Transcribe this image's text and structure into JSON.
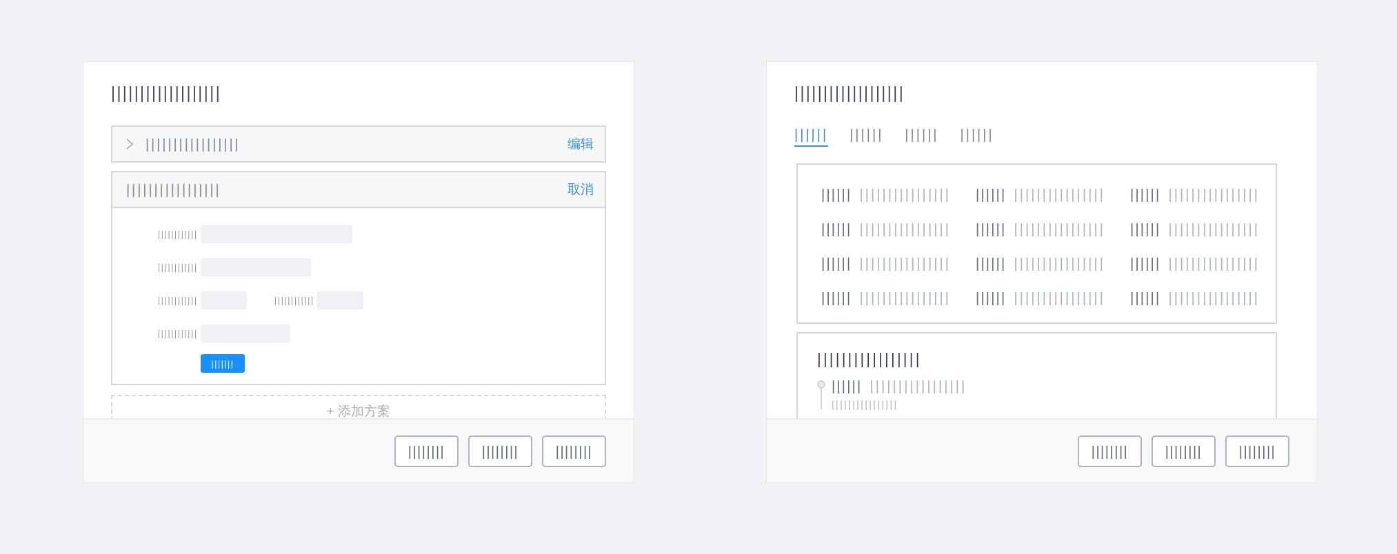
{
  "cards": [
    {
      "kind": "plans",
      "title": "|||||||||||||||||||",
      "panels": [
        {
          "title": "|||||||||||||||||",
          "action": "编辑",
          "expanded": false
        },
        {
          "title": "|||||||||||||||||",
          "action": "取消",
          "expanded": true,
          "field_rows": [
            [
              {
                "label": "||||||||||||"
              }
            ],
            [
              {
                "label": "||||||||||||"
              }
            ],
            [
              {
                "label": "||||||||||||"
              },
              {
                "label": "||||||||||||"
              }
            ],
            [
              {
                "label": "||||||||||||"
              }
            ]
          ],
          "submit": "|||||||"
        }
      ],
      "add_button": "+ 添加方案",
      "footer_buttons": [
        "||||||||",
        "||||||||",
        "||||||||"
      ]
    },
    {
      "kind": "details",
      "title": "|||||||||||||||||||",
      "tabs": [
        {
          "label": "||||||",
          "selected": true
        },
        {
          "label": "||||||",
          "selected": false
        },
        {
          "label": "||||||",
          "selected": false
        },
        {
          "label": "||||||",
          "selected": false
        }
      ],
      "info_grid": [
        {
          "label": "||||||",
          "value": "||||||||||||||||"
        },
        {
          "label": "||||||",
          "value": "||||||||||||||||"
        },
        {
          "label": "||||||",
          "value": "||||||||||||||||"
        },
        {
          "label": "||||||",
          "value": "||||||||||||||||"
        },
        {
          "label": "||||||",
          "value": "||||||||||||||||"
        },
        {
          "label": "||||||",
          "value": "||||||||||||||||"
        },
        {
          "label": "||||||",
          "value": "||||||||||||||||"
        },
        {
          "label": "||||||",
          "value": "||||||||||||||||"
        },
        {
          "label": "||||||",
          "value": "||||||||||||||||"
        },
        {
          "label": "||||||",
          "value": "||||||||||||||||"
        },
        {
          "label": "||||||",
          "value": "||||||||||||||||"
        },
        {
          "label": "||||||",
          "value": "||||||||||||||||"
        }
      ],
      "timeline": {
        "title": "|||||||||||||||||",
        "items": [
          {
            "label": "||||||",
            "value": "|||||||||||||||||",
            "sub": "||||||||||||||||"
          }
        ]
      },
      "footer_buttons": [
        "||||||||",
        "||||||||",
        "||||||||"
      ]
    }
  ]
}
